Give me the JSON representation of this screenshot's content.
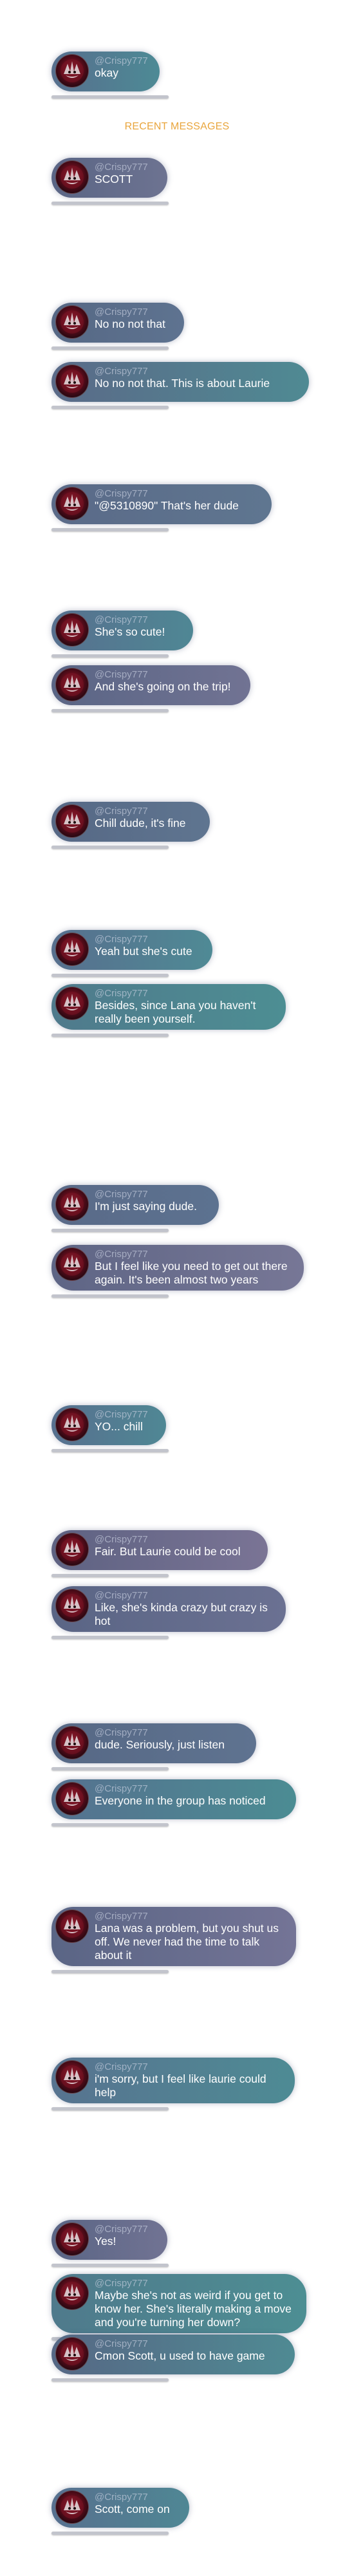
{
  "recent_messages_label": "RECENT MESSAGES",
  "username": "@Crispy777",
  "messages": [
    {
      "text": "okay"
    },
    {
      "text": "SCOTT"
    },
    {
      "text": "No no not that"
    },
    {
      "text": "No no not that. This is about Laurie"
    },
    {
      "text": "\"@5310890\" That's her dude"
    },
    {
      "text": "She's so cute!"
    },
    {
      "text": "And she's going on the trip!"
    },
    {
      "text": "Chill dude, it's fine"
    },
    {
      "text": "Yeah but she's cute"
    },
    {
      "text": "Besides, since Lana you haven't really been yourself."
    },
    {
      "text": "I'm just saying dude."
    },
    {
      "text": "But I feel like you need to get out there again. It's been almost two years"
    },
    {
      "text": "YO... chill"
    },
    {
      "text": "Fair. But Laurie could be cool"
    },
    {
      "text": "Like, she's kinda crazy but crazy is hot"
    },
    {
      "text": "dude. Seriously, just listen"
    },
    {
      "text": "Everyone in the group has noticed"
    },
    {
      "text": "Lana was a problem, but you shut us off. We never had the time to talk about it"
    },
    {
      "text": "i'm sorry, but I feel like laurie could help"
    },
    {
      "text": "Yes!"
    },
    {
      "text": "Maybe she's not as weird if you get to know her. She's literally making a move and you're turning her down?"
    },
    {
      "text": "Cmon Scott, u used to have game"
    },
    {
      "text": "Scott, come on"
    }
  ],
  "colors": {
    "bubble_gradients": [
      [
        "#576f8e",
        "#4d8a95"
      ],
      [
        "#5a6585",
        "#6d7391"
      ],
      [
        "#566885",
        "#5e7390"
      ],
      [
        "#5a6a88",
        "#4f8a93"
      ],
      [
        "#5a6a88",
        "#5f7690"
      ],
      [
        "#57708f",
        "#4f8794"
      ],
      [
        "#5a6585",
        "#717393"
      ],
      [
        "#566885",
        "#5f7590"
      ],
      [
        "#576f8e",
        "#4f8a95"
      ],
      [
        "#4f7a8c",
        "#4d8e93"
      ],
      [
        "#5a6a88",
        "#5c7290"
      ],
      [
        "#5e6585",
        "#777796"
      ],
      [
        "#57708f",
        "#4f8794"
      ],
      [
        "#5e6282",
        "#7a7495"
      ],
      [
        "#5a6585",
        "#6b7192"
      ],
      [
        "#566885",
        "#5f7390"
      ],
      [
        "#55718f",
        "#4b8c93"
      ],
      [
        "#5a6585",
        "#747496"
      ],
      [
        "#577390",
        "#4e8b94"
      ],
      [
        "#5a6585",
        "#717393"
      ],
      [
        "#4f7a8c",
        "#4d8e93"
      ],
      [
        "#566885",
        "#4f8a93"
      ],
      [
        "#57708f",
        "#4f8794"
      ]
    ],
    "header": "#e9a53c"
  }
}
